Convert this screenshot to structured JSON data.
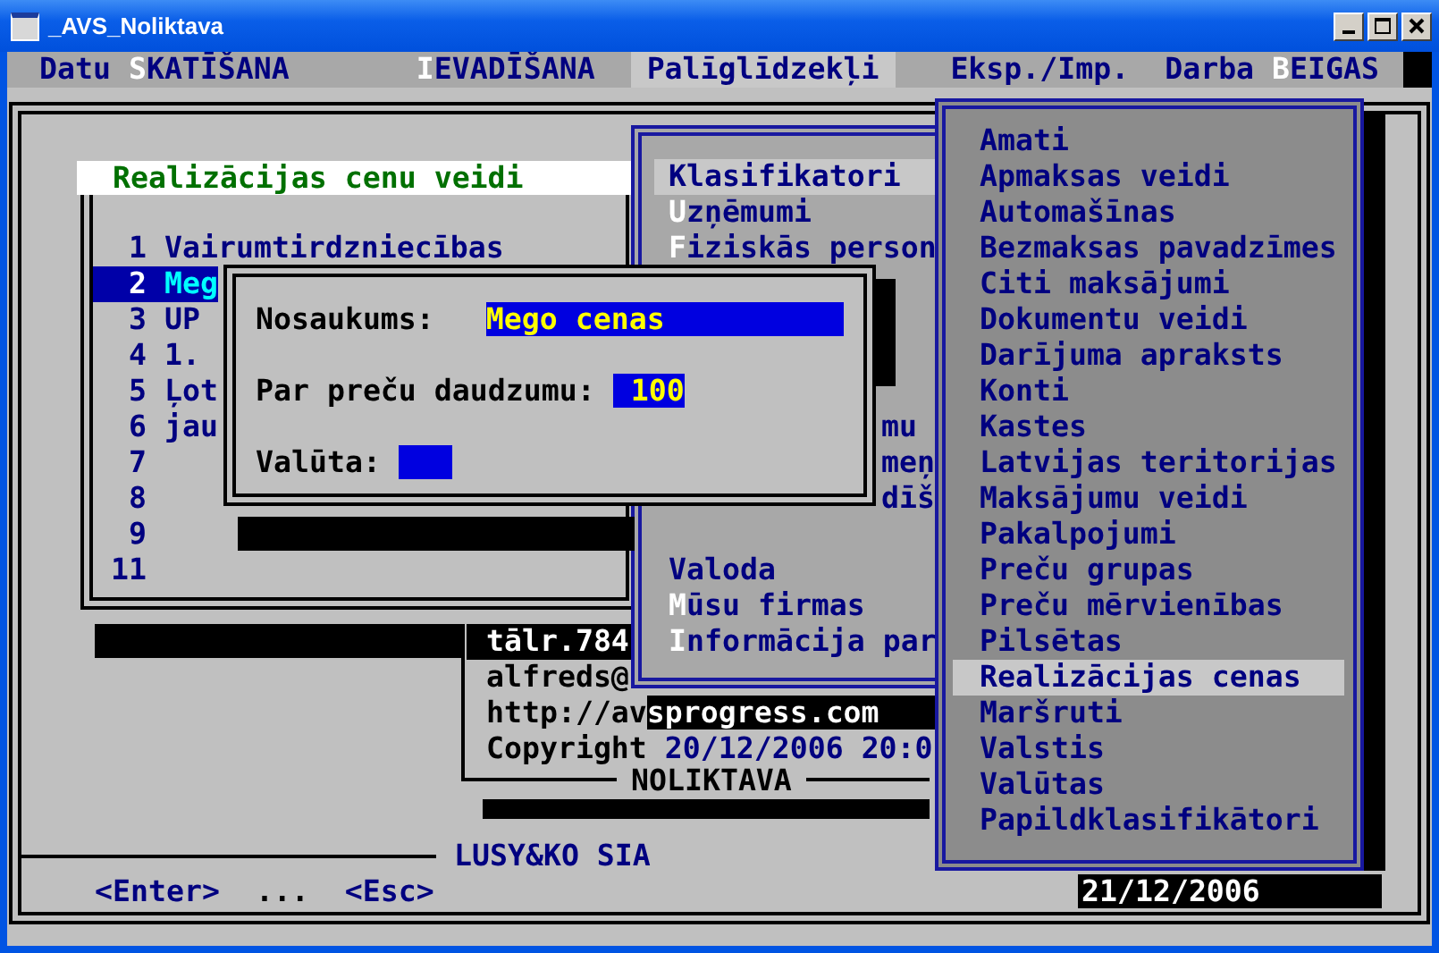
{
  "window": {
    "title": "_AVS_Noliktava"
  },
  "menu_bar": [
    {
      "lead": "Datu ",
      "hotkey": "S",
      "rest": "KATĪŠANA",
      "selected": false
    },
    {
      "hotkey": "I",
      "rest": "EVADĪŠANA",
      "selected": false
    },
    {
      "rest": "Palīglīdzekļi",
      "selected": true
    },
    {
      "rest": "Eksp./Imp.",
      "selected": false
    },
    {
      "lead": "Darba ",
      "hotkey": "B",
      "rest": "EIGAS",
      "selected": false
    }
  ],
  "price_types": {
    "title": "Realizācijas cenu veidi",
    "rows": [
      {
        "number": "1",
        "name": "Vairumtirdzniecības",
        "selected": false
      },
      {
        "number": "2",
        "name": "Meg",
        "selected": true
      },
      {
        "number": "3",
        "name": "UP",
        "selected": false
      },
      {
        "number": "4",
        "name": "1.",
        "selected": false
      },
      {
        "number": "5",
        "name": "Ļot",
        "selected": false
      },
      {
        "number": "6",
        "name": "jau",
        "selected": false
      },
      {
        "number": "7",
        "selected": false
      },
      {
        "number": "8",
        "selected": false
      },
      {
        "number": "9",
        "selected": false
      },
      {
        "number": "11",
        "selected": false
      }
    ]
  },
  "info": {
    "phone": "tālr.784",
    "email": "alfreds@",
    "website": "http://avsprogress.com",
    "copyright_label": "Copyright",
    "build_date": "20/12/2006 20:0",
    "frame_title": "NOLIKTAVA"
  },
  "company": "LUSY&KO SIA",
  "key_hints": [
    "<Enter>",
    "...",
    "<Esc>"
  ],
  "date": "21/12/2006",
  "tools_menu": {
    "upper_items": [
      {
        "rest": "Klasifikatori",
        "selected": true
      },
      {
        "hotkey": "U",
        "rest": "zņēmumi",
        "selected": false
      },
      {
        "hotkey": "F",
        "rest": "iziskās person",
        "selected": false
      }
    ],
    "partial_items": [
      {
        "rest": "mu",
        "selected": false
      },
      {
        "rest": "meņ",
        "selected": false
      },
      {
        "rest": "dīš",
        "selected": false
      }
    ],
    "lower_items": [
      {
        "rest": "Valoda",
        "selected": false
      },
      {
        "hotkey": "M",
        "rest": "ūsu firmas",
        "selected": false
      },
      {
        "hotkey": "I",
        "rest": "nformācija par",
        "selected": false
      }
    ]
  },
  "dialog": {
    "fields": [
      {
        "label": "Nosaukums:",
        "value": "Mego cenas"
      },
      {
        "label": "Par preču daudzumu:",
        "value": "100"
      },
      {
        "label": "Valūta:"
      }
    ]
  },
  "classifier_menu": {
    "items": [
      {
        "label": "Amati",
        "selected": false
      },
      {
        "label": "Apmaksas veidi",
        "selected": false
      },
      {
        "label": "Automašīnas",
        "selected": false
      },
      {
        "label": "Bezmaksas pavadzīmes",
        "selected": false
      },
      {
        "label": "Citi maksājumi",
        "selected": false
      },
      {
        "label": "Dokumentu veidi",
        "selected": false
      },
      {
        "label": "Darījuma apraksts",
        "selected": false
      },
      {
        "label": "Konti",
        "selected": false
      },
      {
        "label": "Kastes",
        "selected": false
      },
      {
        "label": "Latvijas teritorijas",
        "selected": false
      },
      {
        "label": "Maksājumu veidi",
        "selected": false
      },
      {
        "label": "Pakalpojumi",
        "selected": false
      },
      {
        "label": "Preču grupas",
        "selected": false
      },
      {
        "label": "Preču mērvienības",
        "selected": false
      },
      {
        "label": "Pilsētas",
        "selected": false
      },
      {
        "label": "Realizācijas cenas",
        "selected": true
      },
      {
        "label": "Maršruti",
        "selected": false
      },
      {
        "label": "Valstis",
        "selected": false
      },
      {
        "label": "Valūtas",
        "selected": false
      },
      {
        "label": "Papildklasifikātori",
        "selected": false
      }
    ]
  }
}
